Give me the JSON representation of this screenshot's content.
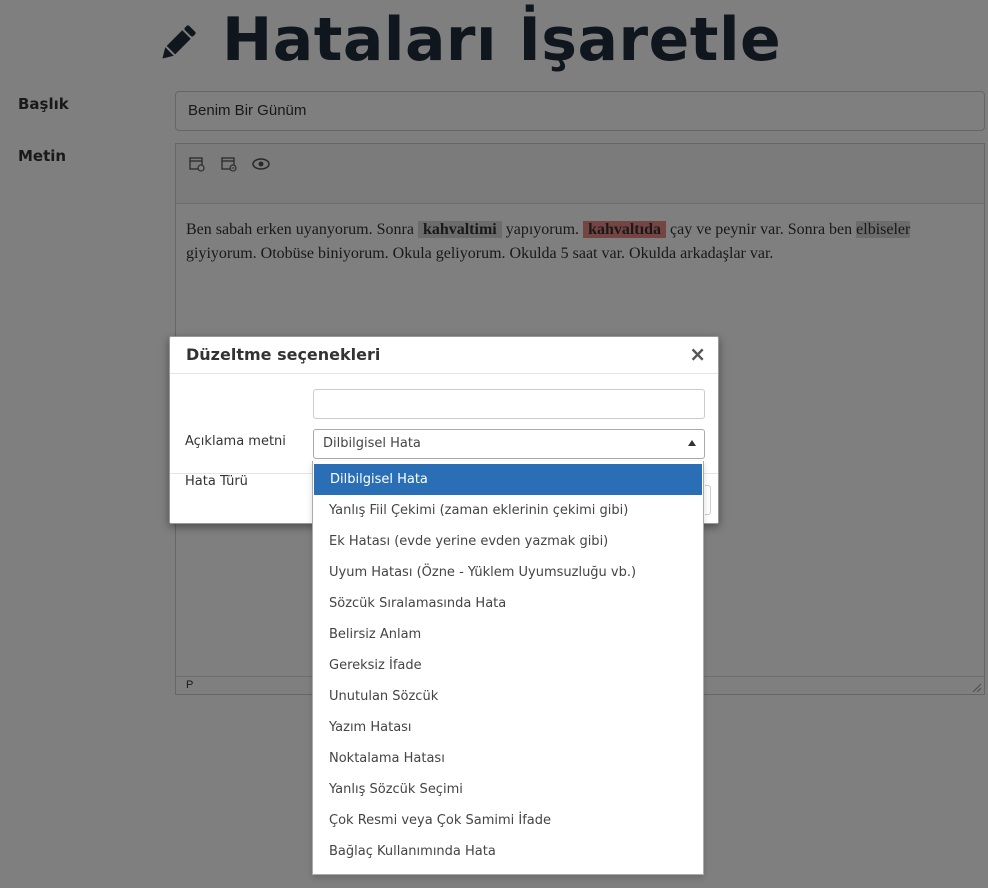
{
  "page": {
    "title": "Hataları İşaretle",
    "title_label": "Başlık",
    "text_label": "Metin",
    "title_value": "Benim Bir Günüm"
  },
  "editor": {
    "segments": {
      "s1": "Ben sabah erken uyanyorum. Sonra ",
      "h1": "kahvaltimi",
      "s2": " yapıyorum. ",
      "h2": "kahvaltıda",
      "s3": " çay ve peynir var. Sonra ben ",
      "h3": "elbiseler",
      "s4": " giyiyorum. Otobüse biniyorum. Okula geliyorum. Okulda 5 saat var. Okulda arkadaşlar var."
    },
    "status_path": "P"
  },
  "modal": {
    "title": "Düzeltme seçenekleri",
    "close": "×",
    "description_label": "Açıklama metni",
    "description_value": "",
    "error_type_label": "Hata Türü",
    "error_type_selected": "Dilbilgisel Hata"
  },
  "dropdown": {
    "options": [
      "Dilbilgisel Hata",
      "Yanlış Fiil Çekimi (zaman eklerinin çekimi gibi)",
      "Ek Hatası (evde yerine evden yazmak gibi)",
      "Uyum Hatası (Özne - Yüklem Uyumsuzluğu vb.)",
      "Sözcük Sıralamasında Hata",
      "Belirsiz Anlam",
      "Gereksiz İfade",
      "Unutulan Sözcük",
      "Yazım Hatası",
      "Noktalama Hatası",
      "Yanlış Sözcük Seçimi",
      "Çok Resmi veya Çok Samimi İfade",
      "Bağlaç Kullanımında Hata"
    ]
  },
  "colors": {
    "backdrop": "#000000",
    "selected_option": "#2a6fb5",
    "highlight_gray": "#d8d8d8",
    "highlight_red": "#e88b86"
  }
}
